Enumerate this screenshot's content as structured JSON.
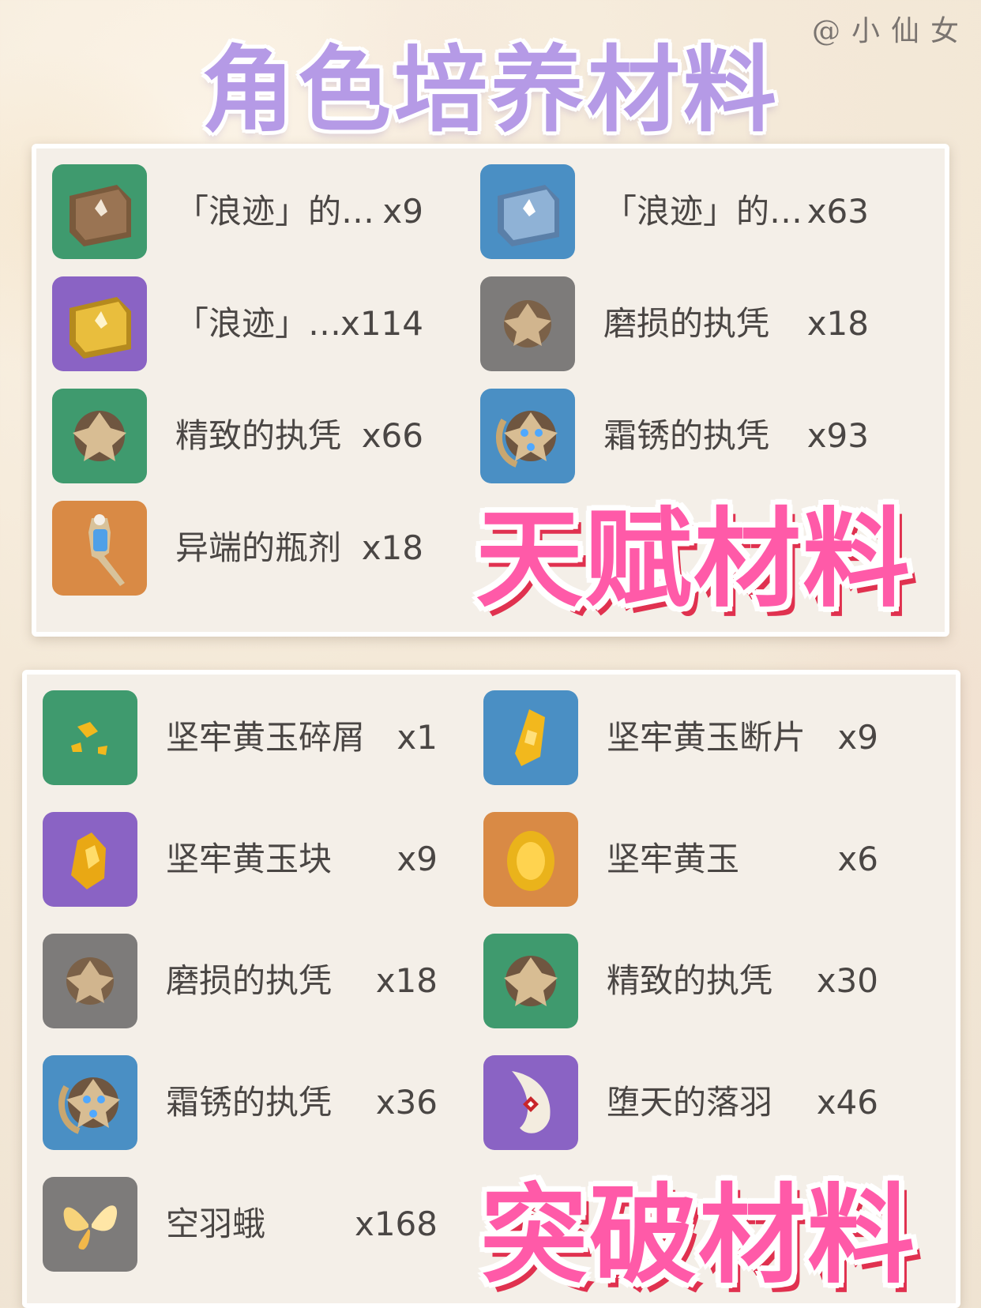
{
  "header": {
    "title": "角色培养材料",
    "watermark": "@小仙女"
  },
  "talent_section": {
    "label": "天赋材料",
    "items": [
      {
        "name": "「浪迹」的…",
        "count": "x9",
        "bg": "#3f9a6e",
        "icon": "book-bronze-icon"
      },
      {
        "name": "「浪迹」的…",
        "count": "x63",
        "bg": "#4a8fc4",
        "icon": "book-silver-icon"
      },
      {
        "name": "「浪迹」…",
        "count": "x114",
        "bg": "#8a63c4",
        "icon": "book-gold-icon"
      },
      {
        "name": "磨损的执凭",
        "count": "x18",
        "bg": "#7d7b7a",
        "icon": "worn-insignia-icon"
      },
      {
        "name": "精致的执凭",
        "count": "x66",
        "bg": "#3f9a6e",
        "icon": "refined-insignia-icon"
      },
      {
        "name": "霜锈的执凭",
        "count": "x93",
        "bg": "#4a8fc4",
        "icon": "frost-insignia-icon"
      },
      {
        "name": "异端的瓶剂",
        "count": "x18",
        "bg": "#d98a45",
        "icon": "heretic-vial-icon"
      }
    ]
  },
  "ascension_section": {
    "label": "突破材料",
    "items": [
      {
        "name": "坚牢黄玉碎屑",
        "count": "x1",
        "bg": "#3f9a6e",
        "icon": "topaz-sliver-icon"
      },
      {
        "name": "坚牢黄玉断片",
        "count": "x9",
        "bg": "#4a8fc4",
        "icon": "topaz-fragment-icon"
      },
      {
        "name": "坚牢黄玉块",
        "count": "x9",
        "bg": "#8a63c4",
        "icon": "topaz-chunk-icon"
      },
      {
        "name": "坚牢黄玉",
        "count": "x6",
        "bg": "#d98a45",
        "icon": "topaz-gemstone-icon"
      },
      {
        "name": "磨损的执凭",
        "count": "x18",
        "bg": "#7d7b7a",
        "icon": "worn-insignia-icon"
      },
      {
        "name": "精致的执凭",
        "count": "x30",
        "bg": "#3f9a6e",
        "icon": "refined-insignia-icon"
      },
      {
        "name": "霜锈的执凭",
        "count": "x36",
        "bg": "#4a8fc4",
        "icon": "frost-insignia-icon"
      },
      {
        "name": "堕天的落羽",
        "count": "x46",
        "bg": "#8a63c4",
        "icon": "fallen-feather-icon"
      },
      {
        "name": "空羽蛾",
        "count": "x168",
        "bg": "#7d7b7a",
        "icon": "moth-wing-icon"
      }
    ]
  },
  "colors": {
    "title": "#b59ae6",
    "sticker": "#ff5aa8",
    "sticker_shadow": "#e0314f",
    "panel": "#f4efe8"
  }
}
